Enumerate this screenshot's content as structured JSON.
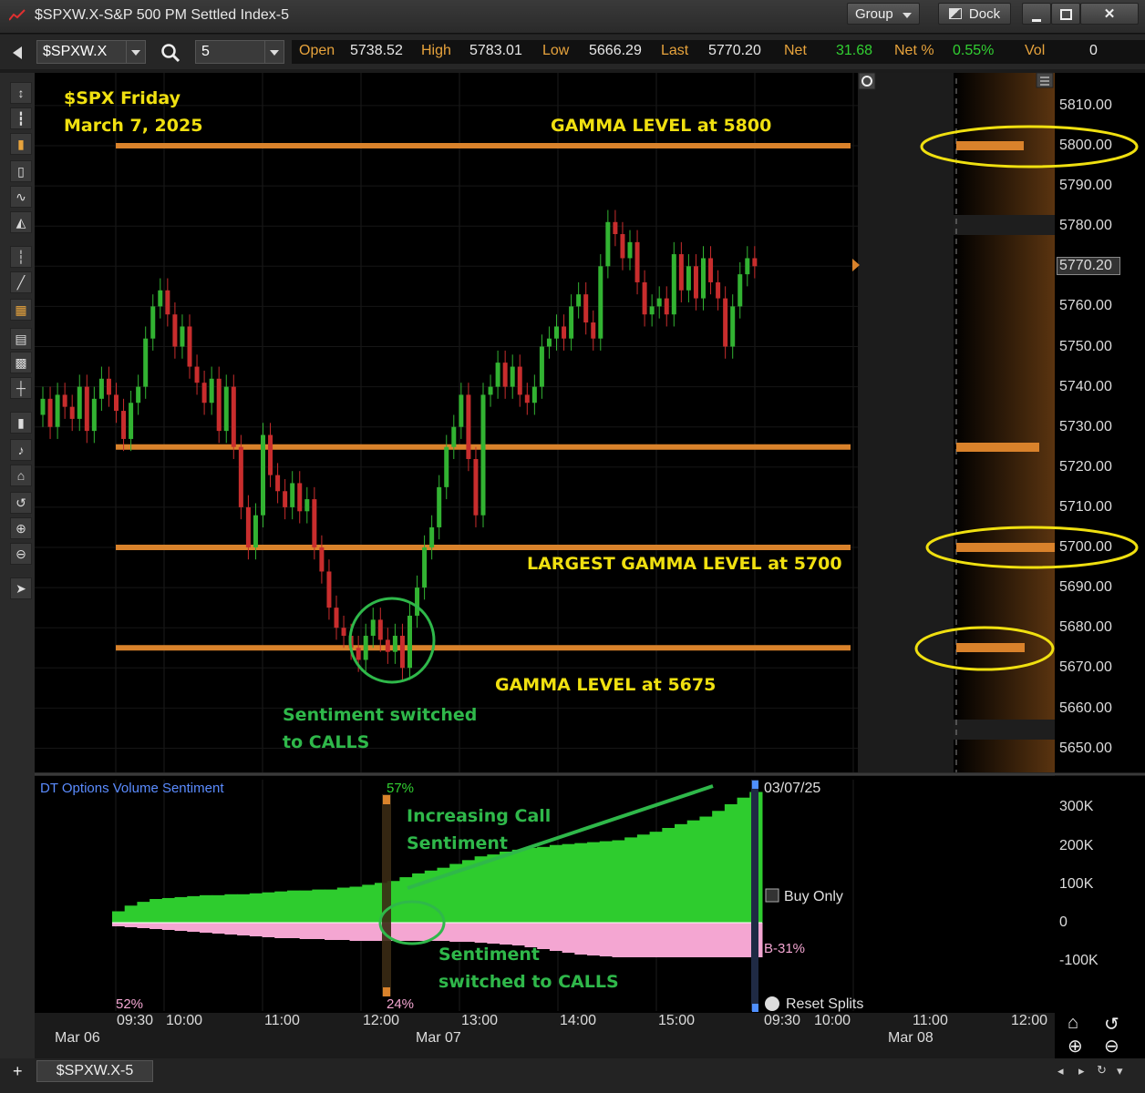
{
  "window": {
    "title": "$SPXW.X-S&P 500 PM Settled Index-5",
    "group_label": "Group",
    "dock_label": "Dock"
  },
  "toolbar": {
    "symbol": "$SPXW.X",
    "interval": "5"
  },
  "quote": {
    "open_label": "Open",
    "open": "5738.52",
    "high_label": "High",
    "high": "5783.01",
    "low_label": "Low",
    "low": "5666.29",
    "last_label": "Last",
    "last": "5770.20",
    "net_label": "Net",
    "net": "31.68",
    "netpct_label": "Net %",
    "netpct": "0.55%",
    "vol_label": "Vol",
    "vol": "0"
  },
  "annotations": {
    "title_line1": "$SPX Friday",
    "title_line2": "March 7, 2025",
    "gamma_5800": "GAMMA LEVEL at 5800",
    "gamma_5700": "LARGEST GAMMA LEVEL at 5700",
    "gamma_5675": "GAMMA LEVEL at 5675",
    "sentiment_line1": "Sentiment switched",
    "sentiment_line2": "to CALLS",
    "increasing_line1": "Increasing Call",
    "increasing_line2": "Sentiment",
    "switched_line1": "Sentiment",
    "switched_line2": "switched to CALLS"
  },
  "price_axis": [
    "5810.00",
    "5800.00",
    "5790.00",
    "5780.00",
    "5770.20",
    "5760.00",
    "5750.00",
    "5740.00",
    "5730.00",
    "5720.00",
    "5710.00",
    "5700.00",
    "5690.00",
    "5680.00",
    "5670.00",
    "5660.00",
    "5650.00"
  ],
  "indicator": {
    "title": "DT Options Volume Sentiment",
    "pct_top": "57%",
    "pct_bottom": "24%",
    "pct_left": "52%",
    "date": "03/07/25",
    "buy_only": "Buy Only",
    "buy_pct": "B-31%",
    "reset_splits": "Reset Splits",
    "axis": [
      "300K",
      "200K",
      "100K",
      "0",
      "-100K"
    ]
  },
  "time_axis": {
    "times": [
      "09:30",
      "10:00",
      "11:00",
      "12:00",
      "13:00",
      "14:00",
      "15:00",
      "09:30",
      "10:00",
      "11:00",
      "12:00"
    ],
    "dates": [
      "Mar 06",
      "Mar 07",
      "Mar 08"
    ]
  },
  "tab": {
    "label": "$SPXW.X-5"
  },
  "colors": {
    "up": "#32b332",
    "down": "#c82d2d",
    "gamma_line": "#d9822b",
    "highlight": "#f0e010",
    "green_ann": "#2fb84a",
    "sentiment_pos": "#2ecc2e",
    "sentiment_neg": "#f4a6d2"
  },
  "chart_data": {
    "type": "candlestick",
    "ylim": [
      5645,
      5815
    ],
    "gamma_levels": [
      5800,
      5725,
      5700,
      5675
    ],
    "last": 5770.2,
    "candles": [
      {
        "o": 5733,
        "c": 5737
      },
      {
        "o": 5737,
        "c": 5730
      },
      {
        "o": 5730,
        "c": 5738
      },
      {
        "o": 5738,
        "c": 5735
      },
      {
        "o": 5735,
        "c": 5732
      },
      {
        "o": 5732,
        "c": 5740
      },
      {
        "o": 5740,
        "c": 5729
      },
      {
        "o": 5729,
        "c": 5737
      },
      {
        "o": 5737,
        "c": 5742
      },
      {
        "o": 5742,
        "c": 5738
      },
      {
        "o": 5738,
        "c": 5734
      },
      {
        "o": 5734,
        "c": 5727
      },
      {
        "o": 5727,
        "c": 5736
      },
      {
        "o": 5736,
        "c": 5740
      },
      {
        "o": 5740,
        "c": 5752
      },
      {
        "o": 5752,
        "c": 5760
      },
      {
        "o": 5760,
        "c": 5764
      },
      {
        "o": 5764,
        "c": 5758
      },
      {
        "o": 5758,
        "c": 5750
      },
      {
        "o": 5750,
        "c": 5755
      },
      {
        "o": 5755,
        "c": 5745
      },
      {
        "o": 5745,
        "c": 5741
      },
      {
        "o": 5741,
        "c": 5736
      },
      {
        "o": 5736,
        "c": 5742
      },
      {
        "o": 5742,
        "c": 5729
      },
      {
        "o": 5729,
        "c": 5740
      },
      {
        "o": 5740,
        "c": 5725
      },
      {
        "o": 5725,
        "c": 5710
      },
      {
        "o": 5710,
        "c": 5700
      },
      {
        "o": 5700,
        "c": 5708
      },
      {
        "o": 5708,
        "c": 5728
      },
      {
        "o": 5728,
        "c": 5718
      },
      {
        "o": 5718,
        "c": 5714
      },
      {
        "o": 5714,
        "c": 5710
      },
      {
        "o": 5710,
        "c": 5716
      },
      {
        "o": 5716,
        "c": 5709
      },
      {
        "o": 5709,
        "c": 5712
      },
      {
        "o": 5712,
        "c": 5700
      },
      {
        "o": 5700,
        "c": 5694
      },
      {
        "o": 5694,
        "c": 5685
      },
      {
        "o": 5685,
        "c": 5680
      },
      {
        "o": 5680,
        "c": 5678
      },
      {
        "o": 5678,
        "c": 5675
      },
      {
        "o": 5675,
        "c": 5672
      },
      {
        "o": 5672,
        "c": 5678
      },
      {
        "o": 5678,
        "c": 5682
      },
      {
        "o": 5682,
        "c": 5677
      },
      {
        "o": 5677,
        "c": 5674
      },
      {
        "o": 5674,
        "c": 5678
      },
      {
        "o": 5678,
        "c": 5670
      },
      {
        "o": 5670,
        "c": 5683
      },
      {
        "o": 5683,
        "c": 5690
      },
      {
        "o": 5690,
        "c": 5700
      },
      {
        "o": 5700,
        "c": 5705
      },
      {
        "o": 5705,
        "c": 5715
      },
      {
        "o": 5715,
        "c": 5725
      },
      {
        "o": 5725,
        "c": 5730
      },
      {
        "o": 5730,
        "c": 5738
      },
      {
        "o": 5738,
        "c": 5722
      },
      {
        "o": 5722,
        "c": 5708
      },
      {
        "o": 5708,
        "c": 5738
      },
      {
        "o": 5738,
        "c": 5740
      },
      {
        "o": 5740,
        "c": 5746
      },
      {
        "o": 5746,
        "c": 5740
      },
      {
        "o": 5740,
        "c": 5745
      },
      {
        "o": 5745,
        "c": 5738
      },
      {
        "o": 5738,
        "c": 5736
      },
      {
        "o": 5736,
        "c": 5740
      },
      {
        "o": 5740,
        "c": 5750
      },
      {
        "o": 5750,
        "c": 5752
      },
      {
        "o": 5752,
        "c": 5755
      },
      {
        "o": 5755,
        "c": 5752
      },
      {
        "o": 5752,
        "c": 5760
      },
      {
        "o": 5760,
        "c": 5763
      },
      {
        "o": 5763,
        "c": 5756
      },
      {
        "o": 5756,
        "c": 5752
      },
      {
        "o": 5752,
        "c": 5770
      },
      {
        "o": 5770,
        "c": 5781
      },
      {
        "o": 5781,
        "c": 5778
      },
      {
        "o": 5778,
        "c": 5772
      },
      {
        "o": 5772,
        "c": 5776
      },
      {
        "o": 5776,
        "c": 5766
      },
      {
        "o": 5766,
        "c": 5758
      },
      {
        "o": 5758,
        "c": 5760
      },
      {
        "o": 5760,
        "c": 5762
      },
      {
        "o": 5762,
        "c": 5758
      },
      {
        "o": 5758,
        "c": 5773
      },
      {
        "o": 5773,
        "c": 5764
      },
      {
        "o": 5764,
        "c": 5770
      },
      {
        "o": 5770,
        "c": 5762
      },
      {
        "o": 5762,
        "c": 5772
      },
      {
        "o": 5772,
        "c": 5766
      },
      {
        "o": 5766,
        "c": 5762
      },
      {
        "o": 5762,
        "c": 5750
      },
      {
        "o": 5750,
        "c": 5760
      },
      {
        "o": 5760,
        "c": 5768
      },
      {
        "o": 5768,
        "c": 5772
      },
      {
        "o": 5772,
        "c": 5770
      }
    ],
    "sentiment_pos": [
      12,
      18,
      22,
      25,
      26,
      27,
      28,
      29,
      29,
      30,
      30,
      31,
      32,
      33,
      34,
      34,
      35,
      35,
      37,
      38,
      40,
      42,
      44,
      48,
      52,
      55,
      58,
      62,
      66,
      70,
      72,
      75,
      77,
      79,
      80,
      82,
      83,
      84,
      85,
      86,
      87,
      90,
      93,
      96,
      100,
      104,
      108,
      112,
      118,
      125,
      132,
      138
    ],
    "sentiment_neg": [
      4,
      5,
      6,
      7,
      8,
      9,
      10,
      11,
      12,
      13,
      14,
      15,
      16,
      17,
      17,
      18,
      18,
      19,
      19,
      20,
      20,
      20,
      20,
      20,
      20,
      20,
      20,
      21,
      21,
      22,
      23,
      24,
      25,
      27,
      29,
      31,
      33,
      35,
      36,
      37,
      38,
      38,
      38,
      38,
      38,
      38,
      38,
      38,
      38,
      38,
      38,
      38
    ]
  }
}
